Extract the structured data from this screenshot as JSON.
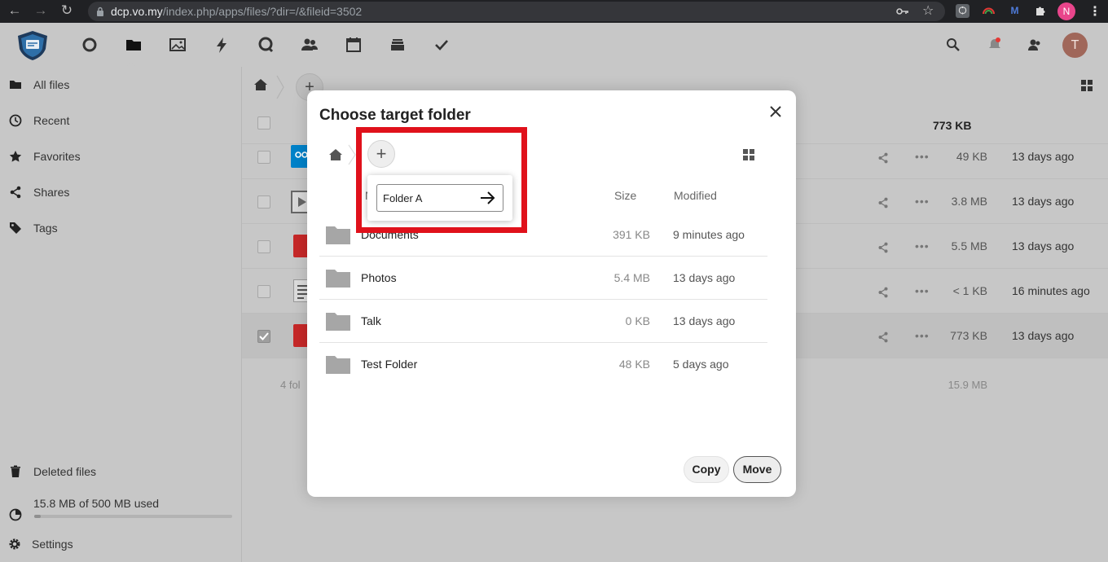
{
  "browser": {
    "url_domain": "dcp.vo.my",
    "url_path": "/index.php/apps/files/?dir=/&fileid=3502",
    "profile_initial": "N"
  },
  "header": {
    "avatar_initial": "T"
  },
  "sidebar": {
    "items": [
      {
        "label": "All files",
        "icon": "folder-icon"
      },
      {
        "label": "Recent",
        "icon": "clock-icon"
      },
      {
        "label": "Favorites",
        "icon": "star-icon"
      },
      {
        "label": "Shares",
        "icon": "share-icon"
      },
      {
        "label": "Tags",
        "icon": "tag-icon"
      }
    ],
    "deleted": "Deleted files",
    "quota": "15.8 MB of 500 MB used",
    "quota_fraction": 0.032,
    "settings": "Settings"
  },
  "files": {
    "header_size": "773 KB",
    "rows": [
      {
        "size": "49 KB",
        "modified": "13 days ago",
        "checked": false
      },
      {
        "size": "3.8 MB",
        "modified": "13 days ago",
        "checked": false
      },
      {
        "size": "5.5 MB",
        "modified": "13 days ago",
        "checked": false
      },
      {
        "size": "< 1 KB",
        "modified": "16 minutes ago",
        "checked": false
      },
      {
        "size": "773 KB",
        "modified": "13 days ago",
        "checked": true
      }
    ],
    "summary_left": "4 fol",
    "summary_size": "15.9 MB"
  },
  "modal": {
    "title": "Choose target folder",
    "new_folder_value": "Folder A",
    "col_name_partial": "N",
    "col_size": "Size",
    "col_modified": "Modified",
    "rows": [
      {
        "name": "Documents",
        "size": "391 KB",
        "modified": "9 minutes ago"
      },
      {
        "name": "Photos",
        "size": "5.4 MB",
        "modified": "13 days ago"
      },
      {
        "name": "Talk",
        "size": "0 KB",
        "modified": "13 days ago"
      },
      {
        "name": "Test Folder",
        "size": "48 KB",
        "modified": "5 days ago"
      }
    ],
    "copy_label": "Copy",
    "move_label": "Move"
  },
  "colors": {
    "highlight": "#e0111b",
    "accent": "#0082c9"
  }
}
